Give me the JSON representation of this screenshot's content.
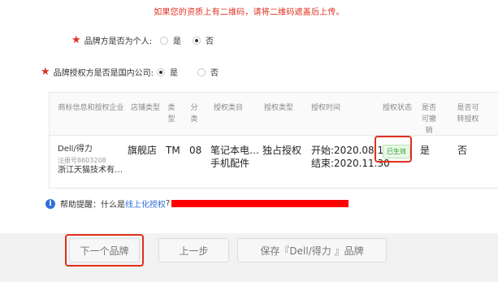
{
  "notice": "如果您的资质上有二维码，请将二维码遮盖后上传。",
  "form": {
    "q1": {
      "required": "★",
      "label": "品牌方是否为个人:",
      "options": [
        "是",
        "否"
      ],
      "selected": "否"
    },
    "q2": {
      "required": "★",
      "label": "品牌授权方是否是国内公司:",
      "options": [
        "是",
        "否"
      ],
      "selected": "是"
    }
  },
  "table": {
    "headers": [
      "商标信息和授权企业",
      "店铺类型",
      "类型",
      "分类",
      "授权类目",
      "授权类型",
      "授权时间",
      "授权状态",
      "是否可撤销",
      "是否可转授权"
    ],
    "row": {
      "brand": "Dell/得力",
      "reg_no": "注册号8603208",
      "company": "浙江天猫技术有…",
      "shop_type": "旗舰店",
      "type": "TM",
      "class": "08",
      "category_line1": "笔记本电…",
      "category_line2": "手机配件",
      "auth_type": "独占授权",
      "start": "开始:2020.08.10",
      "end": "结束:2020.11.30",
      "status": "已生效",
      "revocable": "是",
      "transferable": "否"
    }
  },
  "tip": {
    "icon": "info-icon",
    "prefix": "帮助提醒：什么是",
    "link": "线上化授权",
    "suffix": "?"
  },
  "buttons": {
    "next_brand": "下一个品牌",
    "prev_step": "上一步",
    "save": "保存『Dell/得力 』品牌"
  },
  "colors": {
    "accent_red": "#e0301e",
    "link_blue": "#2f6fd8",
    "status_green": "#2f9e2a"
  }
}
